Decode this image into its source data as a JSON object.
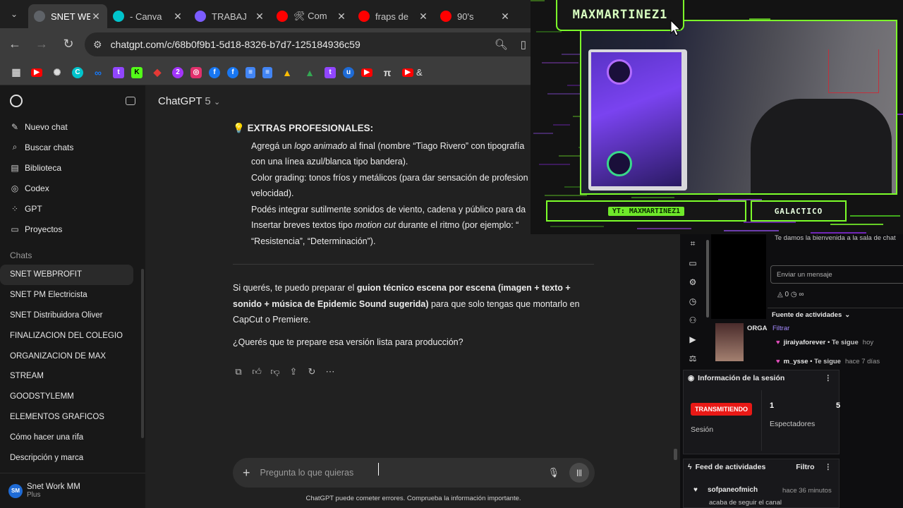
{
  "browser": {
    "tabs": [
      {
        "label": "SNET WE",
        "icon": "chatgpt-icon",
        "color": "#5f6368",
        "active": true
      },
      {
        "label": "- Canva",
        "icon": "canva-icon",
        "color": "#00c4cc"
      },
      {
        "label": "TRABAJ",
        "icon": "heart-icon",
        "color": "#7b5cff"
      },
      {
        "label": "🛠 Com",
        "icon": "youtube-icon",
        "color": "#ff0000"
      },
      {
        "label": "fraps de",
        "icon": "youtube-icon",
        "color": "#ff0000"
      },
      {
        "label": "90's",
        "icon": "youtube-icon",
        "color": "#ff0000"
      }
    ],
    "url": "chatgpt.com/c/68b0f9b1-5d18-8326-b7d7-125184936c59",
    "bookmark_text": "&"
  },
  "sidebar": {
    "nav": [
      {
        "label": "Nuevo chat",
        "icon": "edit-icon"
      },
      {
        "label": "Buscar chats",
        "icon": "search-icon"
      },
      {
        "label": "Biblioteca",
        "icon": "library-icon"
      },
      {
        "label": "Codex",
        "icon": "codex-icon"
      },
      {
        "label": "GPT",
        "icon": "grid-icon"
      },
      {
        "label": "Proyectos",
        "icon": "folder-icon"
      }
    ],
    "section_title": "Chats",
    "chats": [
      "SNET WEBPROFIT",
      "SNET PM Electricista",
      "SNET Distribuidora Oliver",
      "FINALIZACION DEL COLEGIO",
      "ORGANIZACION DE MAX",
      "STREAM",
      "GOODSTYLEMM",
      "ELEMENTOS GRAFICOS",
      "Cómo hacer una rifa",
      "Descripción y marca"
    ],
    "user": {
      "initials": "SM",
      "name": "Snet Work MM",
      "plan": "Plus"
    }
  },
  "main": {
    "model_name": "ChatGPT",
    "model_version": "5",
    "extras_title": "EXTRAS PROFESIONALES:",
    "bullets": [
      [
        "Agregá un ",
        "logo animado",
        " al final (nombre “Tiago Rivero” con tipografía"
      ],
      [
        "con una línea azul/blanca tipo bandera).",
        "",
        ""
      ],
      [
        "Color grading: tonos fríos y metálicos (para dar sensación de profesion",
        "",
        ""
      ],
      [
        "velocidad).",
        "",
        ""
      ],
      [
        "Podés integrar sutilmente sonidos de viento, cadena y público para da",
        "",
        ""
      ],
      [
        "Insertar breves textos tipo ",
        "motion cut",
        " durante el ritmo (por ejemplo: “"
      ],
      [
        "“Resistencia”, “Determinación”).",
        "",
        ""
      ]
    ],
    "para1_a": "Si querés, te puedo preparar el ",
    "para1_b": "guion técnico escena por escena (imagen + texto + sonido + música de Epidemic Sound sugerida)",
    "para1_c": " para que solo tengas que montarlo en CapCut o Premiere.",
    "para2": "¿Querés que te prepare esa versión lista para producción?",
    "input_placeholder": "Pregunta lo que quieras",
    "disclaimer": "ChatGPT puede cometer errores. Comprueba la información importante."
  },
  "overlay": {
    "channel_name": "MAXMARTINEZ1",
    "yt_tag": "YT: MAXMARTINEZ1",
    "rank": "GALACTICO"
  },
  "dashboard": {
    "welcome": "Te damos la bienvenida a la sala de chat",
    "chat_placeholder": "Enviar un mensaje",
    "points": "0",
    "feed_title": "Fuente de actividades",
    "filter_label": "Filtrar",
    "feed_row_org": "ORGA",
    "feed_rows": [
      {
        "user": "jiraiyaforever",
        "action": "Te sigue",
        "time": "hoy"
      },
      {
        "user": "m_ysse",
        "action": "Te sigue",
        "time": "hace 7 días"
      }
    ],
    "session_title": "Información de la sesión",
    "live_label": "TRANSMITIENDO",
    "session_label": "Sesión",
    "viewers": "1",
    "viewers_label": "Espectadores",
    "second_stat": "5",
    "activity_title": "Feed de actividades",
    "activity_filter": "Filtro",
    "activity_user": "sofpaneofmich",
    "activity_time": "hace 36 minutos",
    "activity_action": "acaba de seguir el canal"
  }
}
